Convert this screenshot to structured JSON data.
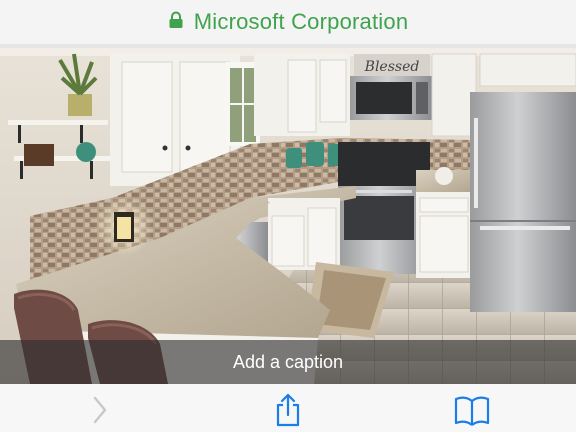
{
  "header": {
    "title": "Microsoft Corporation",
    "lock_icon": "lock-icon",
    "title_color": "#3fa34d"
  },
  "photo": {
    "sign_text": "Blessed",
    "caption_placeholder": "Add a caption"
  },
  "toolbar": {
    "icons": [
      "chevron-right-icon",
      "share-icon",
      "book-icon"
    ],
    "icon_color": "#1a7ee6",
    "disabled_color": "#c8c8c8"
  }
}
